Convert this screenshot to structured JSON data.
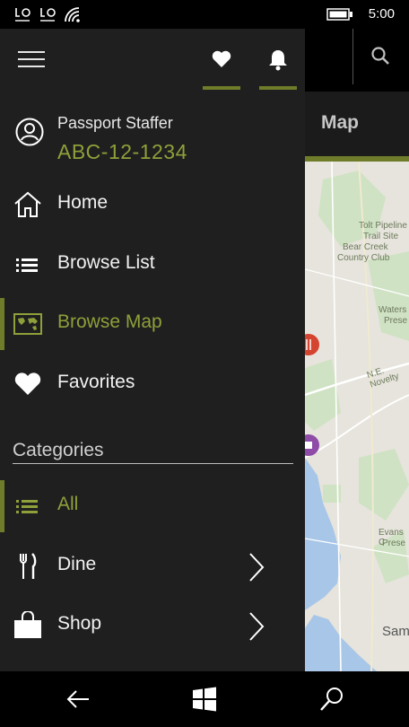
{
  "status_bar": {
    "time": "5:00",
    "icons": [
      "missed-call-icon",
      "voicemail-icon",
      "wifi-icon",
      "battery-icon"
    ]
  },
  "app_bar": {
    "menu_icon": "hamburger-icon",
    "favorites_icon": "heart-icon",
    "notifications_icon": "bell-icon",
    "search_icon": "search-icon"
  },
  "background": {
    "active_tab": "Map",
    "map_labels": [
      "Tolt Pipeline",
      "Trail Site",
      "Bear Creek",
      "Country Club",
      "Waters",
      "Prese",
      "N.E. Novelty",
      "Evans C",
      "Prese",
      "Sam"
    ]
  },
  "profile": {
    "name": "Passport Staffer",
    "id": "ABC-12-1234"
  },
  "nav": {
    "home": "Home",
    "browse_list": "Browse List",
    "browse_map": "Browse Map",
    "favorites": "Favorites"
  },
  "categories": {
    "header": "Categories",
    "all": "All",
    "dine": "Dine",
    "shop": "Shop"
  },
  "colors": {
    "accent": "#8ea03a",
    "accent_dark": "#6f7c2a",
    "drawer_bg": "#1f1f1f"
  },
  "bottom_nav": {
    "back_icon": "back-arrow-icon",
    "windows_icon": "windows-icon",
    "search_icon": "search-icon"
  }
}
